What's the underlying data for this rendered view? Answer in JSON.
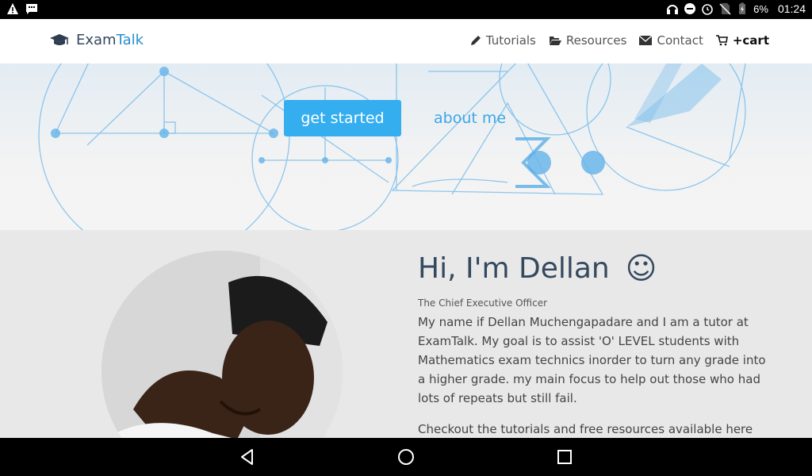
{
  "status_bar": {
    "battery": "6%",
    "time": "01:24",
    "icons": [
      "warning-icon",
      "message-icon",
      "headphones-icon",
      "do-not-disturb-icon",
      "alarm-icon",
      "no-sim-icon",
      "battery-charging-icon"
    ]
  },
  "navbar": {
    "brand_part1": "Exam",
    "brand_part2": "Talk",
    "items": [
      {
        "label": "Tutorials",
        "icon": "pencil-icon"
      },
      {
        "label": "Resources",
        "icon": "folder-open-icon"
      },
      {
        "label": "Contact",
        "icon": "envelope-icon"
      },
      {
        "label": "+cart",
        "icon": "cart-icon"
      }
    ]
  },
  "hero": {
    "get_started": "get started",
    "about_me": "about me"
  },
  "profile": {
    "heading": "Hi, I'm Dellan",
    "emoji": "☺",
    "role": "The Chief Executive Officer",
    "bio": "My name if Dellan Muchengapadare and I am a tutor at ExamTalk. My goal is to assist 'O' LEVEL students with Mathematics exam technics inorder to turn any grade into a higher grade. my main focus to help out those who had lots of repeats but still fail.",
    "checkout": "Checkout the tutorials and free resources available here"
  },
  "colors": {
    "accent": "#35aef0",
    "brand_text": "#34495e",
    "brand_highlight": "#2a8fcf"
  }
}
